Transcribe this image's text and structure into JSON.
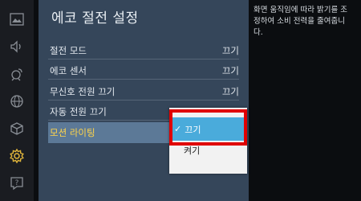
{
  "rail": {
    "icons": [
      "picture-icon",
      "sound-icon",
      "broadcast-icon",
      "network-icon",
      "cube-icon",
      "gear-icon",
      "support-icon"
    ],
    "active_icon": "gear-icon"
  },
  "panel": {
    "title": "에코 절전 설정",
    "items": [
      {
        "label": "절전 모드",
        "value": "끄기"
      },
      {
        "label": "에코 센서",
        "value": "끄기"
      },
      {
        "label": "무신호 전원 끄기",
        "value": "끄기"
      },
      {
        "label": "자동 전원 끄기",
        "value": ""
      },
      {
        "label": "모션 라이팅",
        "value": ""
      }
    ]
  },
  "dropdown": {
    "selected": "끄기",
    "other": "켜기"
  },
  "description": "화면 움직임에 따라 밝기를 조정하여 소비 전력을 줄여줍니다.",
  "colors": {
    "panel_bg": "#35465a",
    "active_text": "#ffd54a",
    "selected_option": "#4aabdb",
    "highlight": "#e00000"
  }
}
